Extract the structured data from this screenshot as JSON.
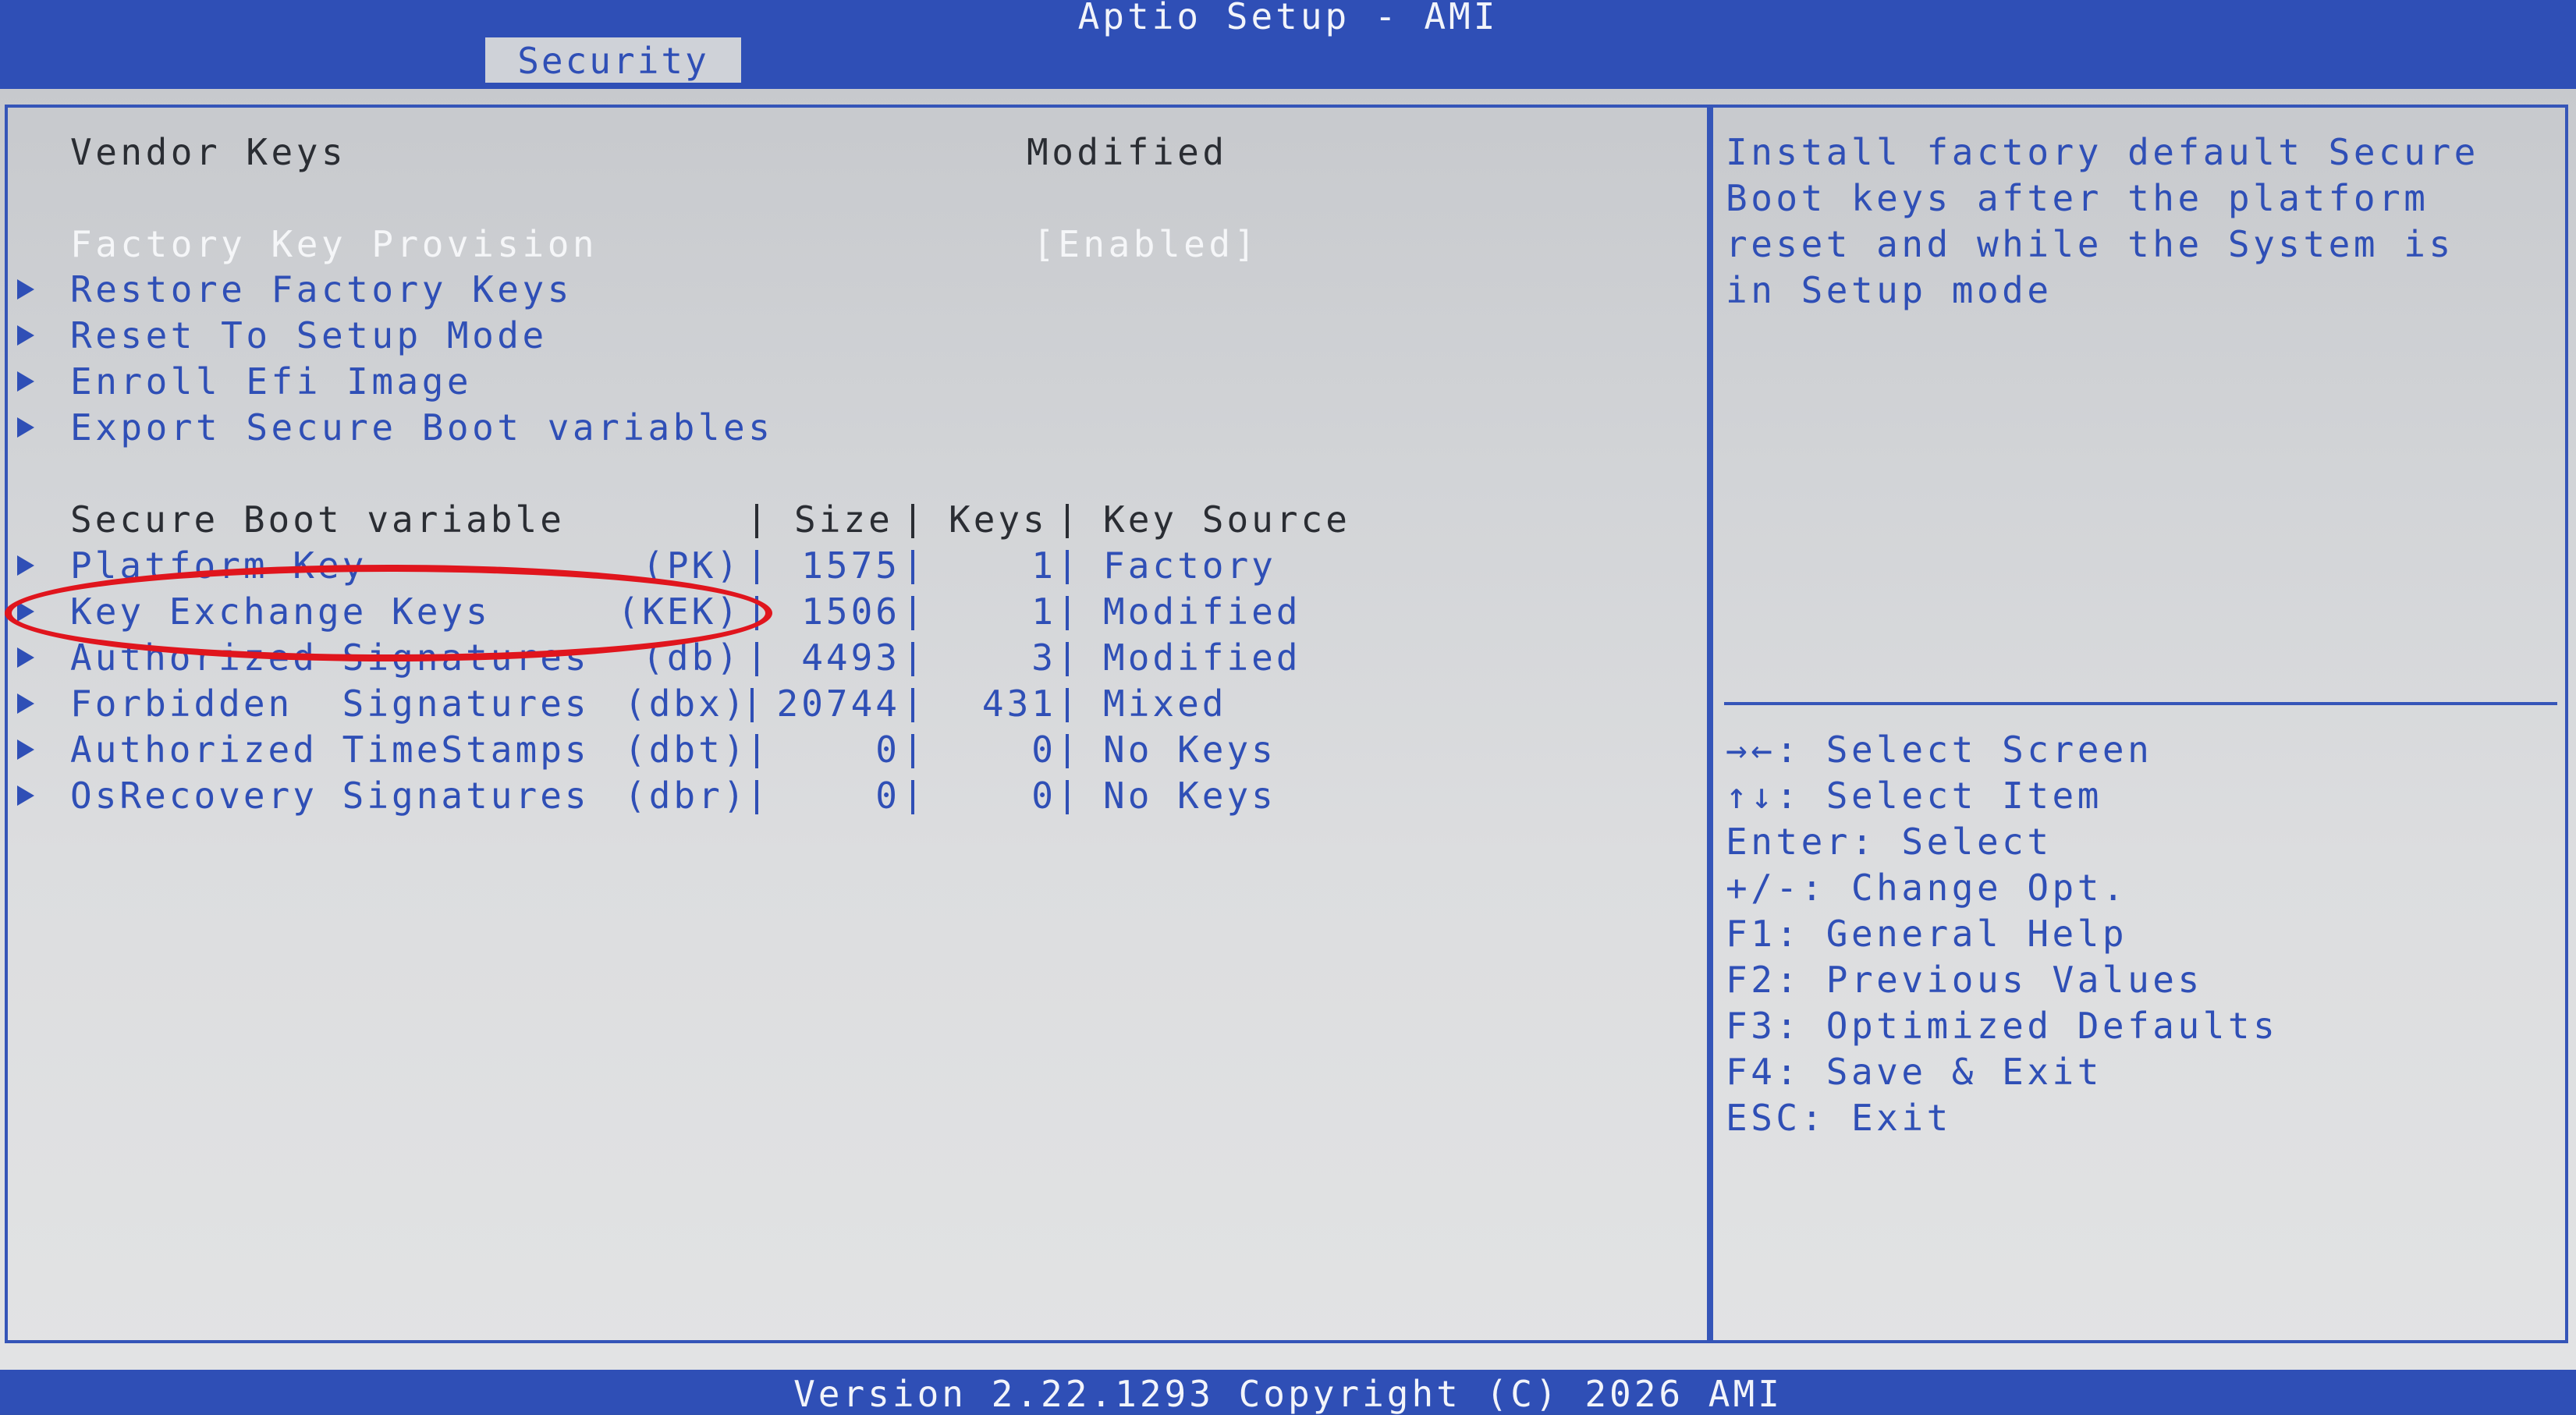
{
  "app": {
    "title": "Aptio Setup - AMI"
  },
  "tabs": [
    {
      "label": "Security"
    }
  ],
  "vendor_keys": {
    "label": "Vendor Keys",
    "value": "Modified"
  },
  "factory_key_provision": {
    "label": "Factory Key Provision",
    "value": "[Enabled]"
  },
  "menu_items": [
    {
      "label": "Restore Factory Keys"
    },
    {
      "label": "Reset To Setup Mode"
    },
    {
      "label": "Enroll Efi Image"
    },
    {
      "label": "Export Secure Boot variables"
    }
  ],
  "variables_table": {
    "headers": {
      "variable": "Secure Boot variable",
      "size": "Size",
      "keys": "Keys",
      "source": "Key Source"
    },
    "rows": [
      {
        "name": "Platform Key",
        "abbr": "(PK)",
        "size": "1575",
        "keys": "1",
        "source": "Factory"
      },
      {
        "name": "Key Exchange Keys",
        "abbr": "(KEK)",
        "size": "1506",
        "keys": "1",
        "source": "Modified"
      },
      {
        "name": "Authorized Signatures",
        "abbr": "(db)",
        "size": "4493",
        "keys": "3",
        "source": "Modified"
      },
      {
        "name": "Forbidden  Signatures",
        "abbr": "(dbx)",
        "size": "20744",
        "keys": "431",
        "source": "Mixed"
      },
      {
        "name": "Authorized TimeStamps",
        "abbr": "(dbt)",
        "size": "0",
        "keys": "0",
        "source": "No Keys"
      },
      {
        "name": "OsRecovery Signatures",
        "abbr": "(dbr)",
        "size": "0",
        "keys": "0",
        "source": "No Keys"
      }
    ]
  },
  "help": {
    "lines": [
      "Install factory default Secure",
      "Boot keys after the platform",
      "reset and while the System is",
      "in Setup mode"
    ]
  },
  "key_help": [
    {
      "keys": "→←",
      "text": ": Select Screen"
    },
    {
      "keys": "↑↓",
      "text": ": Select Item"
    },
    {
      "keys": "Enter",
      "text": ": Select"
    },
    {
      "keys": "+/-",
      "text": ": Change Opt."
    },
    {
      "keys": "F1",
      "text": ": General Help"
    },
    {
      "keys": "F2",
      "text": ": Previous Values"
    },
    {
      "keys": "F3",
      "text": ": Optimized Defaults"
    },
    {
      "keys": "F4",
      "text": ": Save & Exit"
    },
    {
      "keys": "ESC",
      "text": ": Exit"
    }
  ],
  "footer": {
    "text": "Version 2.22.1293 Copyright (C) 2026 AMI"
  },
  "colors": {
    "header_blue": "#2f4fb6",
    "panel_gray": "#d2d4d7",
    "annotation_red": "#e0151d"
  }
}
